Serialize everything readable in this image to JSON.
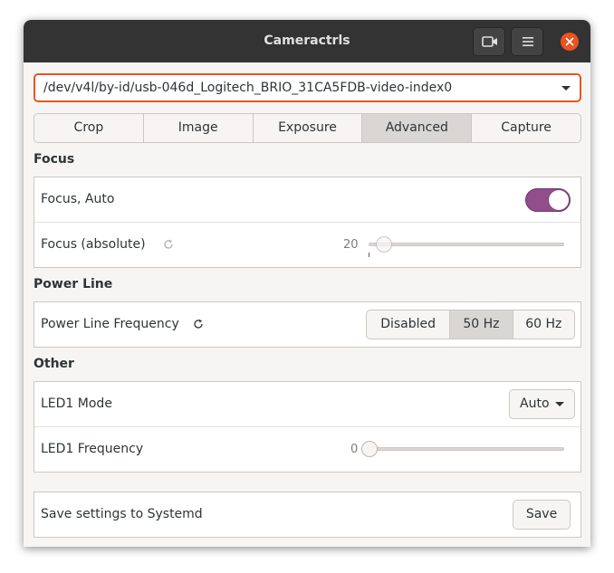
{
  "window": {
    "title": "Cameractrls"
  },
  "device": {
    "selected": "/dev/v4l/by-id/usb-046d_Logitech_BRIO_31CA5FDB-video-index0"
  },
  "tabs": [
    {
      "label": "Crop",
      "active": false
    },
    {
      "label": "Image",
      "active": false
    },
    {
      "label": "Exposure",
      "active": false
    },
    {
      "label": "Advanced",
      "active": true
    },
    {
      "label": "Capture",
      "active": false
    }
  ],
  "sections": {
    "focus": {
      "title": "Focus",
      "focus_auto": {
        "label": "Focus, Auto",
        "enabled": true
      },
      "focus_absolute": {
        "label": "Focus (absolute)",
        "value": "20"
      }
    },
    "power_line": {
      "title": "Power Line",
      "frequency": {
        "label": "Power Line Frequency",
        "options": [
          "Disabled",
          "50 Hz",
          "60 Hz"
        ],
        "selected": "50 Hz"
      }
    },
    "other": {
      "title": "Other",
      "led1_mode": {
        "label": "LED1 Mode",
        "value": "Auto"
      },
      "led1_frequency": {
        "label": "LED1 Frequency",
        "value": "0"
      }
    }
  },
  "systemd": {
    "label": "Save settings to Systemd",
    "save_label": "Save"
  },
  "colors": {
    "titlebar": "#333333",
    "accent": "#e95420",
    "switch_on": "#924d8b"
  }
}
